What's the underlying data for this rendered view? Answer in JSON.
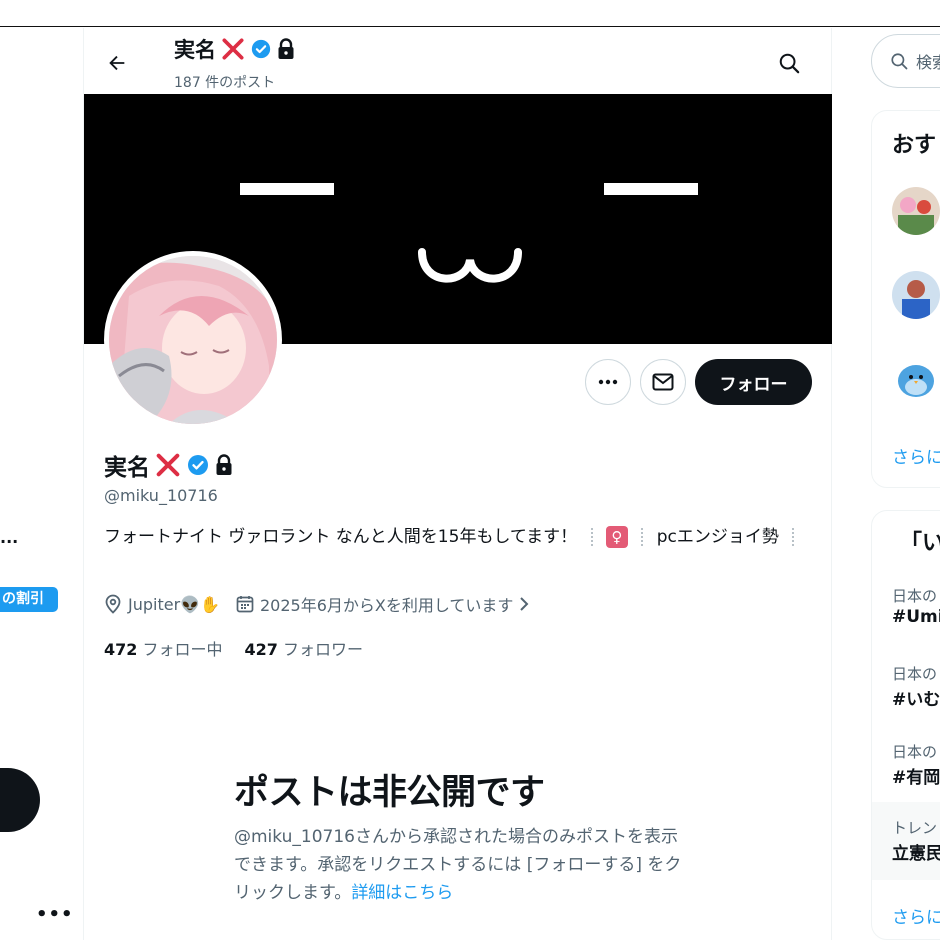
{
  "header": {
    "name": "実名",
    "post_count": "187 件のポスト"
  },
  "profile": {
    "name": "実名",
    "handle": "@miku_10716",
    "bio_part1": "フォートナイト ヴァロラント なんと人間を15年もしてます！",
    "bio_female_glyph": "♀",
    "bio_part2": "pcエンジョイ勢",
    "location": "Jupiter👽✋",
    "joined": "2025年6月からXを利用しています",
    "following_count": "472",
    "following_label": "フォロー中",
    "followers_count": "427",
    "followers_label": "フォロワー",
    "follow_button": "フォロー"
  },
  "private": {
    "title": "ポストは非公開です",
    "description": "@miku_10716さんから承認された場合のみポストを表示できます。承認をリクエストするには [フォローする] をクリックします。",
    "link": "詳細はこちら"
  },
  "left_sidebar": {
    "ellipsis": "...",
    "badge": "の割引",
    "more": "•••"
  },
  "right_sidebar": {
    "search_placeholder": "検索",
    "recommend_title": "おす",
    "show_more_1": "さらに",
    "trends_title": "「い",
    "trends": [
      {
        "category": "日本の",
        "name": "#Umi"
      },
      {
        "category": "日本の",
        "name": "#いむ"
      },
      {
        "category": "日本の",
        "name": "#有岡"
      },
      {
        "category": "トレン",
        "name": "立憲民"
      }
    ],
    "show_more_2": "さらに"
  },
  "colors": {
    "accent": "#1d9bf0",
    "text": "#0f1419",
    "secondary": "#536471",
    "banner": "#000000",
    "x_mark": "#dd2e44"
  }
}
